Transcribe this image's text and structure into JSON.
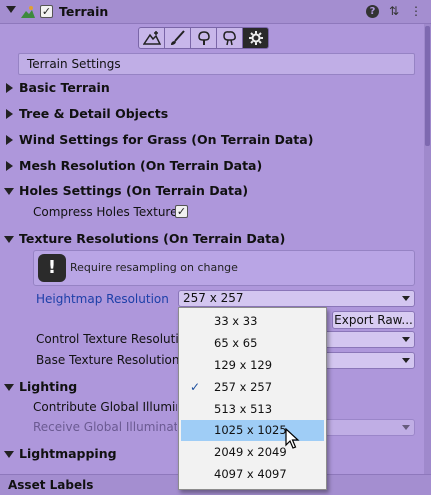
{
  "header": {
    "title": "Terrain",
    "enabled_check": "✓",
    "help_icon": "?",
    "presets_icon": "⇅",
    "menu_icon": "⋮"
  },
  "tools": [
    {
      "name": "raise-lower-terrain-icon",
      "active": false
    },
    {
      "name": "paint-texture-icon",
      "active": false
    },
    {
      "name": "paint-trees-icon",
      "active": false
    },
    {
      "name": "paint-details-icon",
      "active": false
    },
    {
      "name": "terrain-settings-icon",
      "active": true
    }
  ],
  "settings_title": "Terrain Settings",
  "sections": {
    "basic": "Basic Terrain",
    "trees": "Tree & Detail Objects",
    "wind": "Wind Settings for Grass (On Terrain Data)",
    "mesh": "Mesh Resolution (On Terrain Data)",
    "holes": "Holes Settings (On Terrain Data)",
    "texres": "Texture Resolutions (On Terrain Data)",
    "lighting": "Lighting",
    "lightmapping": "Lightmapping"
  },
  "holes": {
    "compress_label": "Compress Holes Texture",
    "compress_check": "✓"
  },
  "texres": {
    "help_icon": "!",
    "help_text": "Require resampling on change",
    "heightmap_label": "Heightmap Resolution",
    "heightmap_value": "257 x 257",
    "export_label": "Export Raw...",
    "control_label": "Control Texture Resolution",
    "base_label": "Base Texture Resolution"
  },
  "lighting": {
    "contribute_label": "Contribute Global Illumination",
    "receive_label": "Receive Global Illumination"
  },
  "popup": {
    "check": "✓",
    "options": [
      "33 x 33",
      "65 x 65",
      "129 x 129",
      "257 x 257",
      "513 x 513",
      "1025 x 1025",
      "2049 x 2049",
      "4097 x 4097"
    ],
    "selected_index": 3,
    "hover_index": 5
  },
  "footer": {
    "label": "Asset Labels"
  },
  "colors": {
    "background": "#ae97db",
    "header": "#a48ed0",
    "label_blue": "#1d3fa8",
    "hover": "#9fcdf6",
    "popup_bg": "#f2f2f2"
  }
}
